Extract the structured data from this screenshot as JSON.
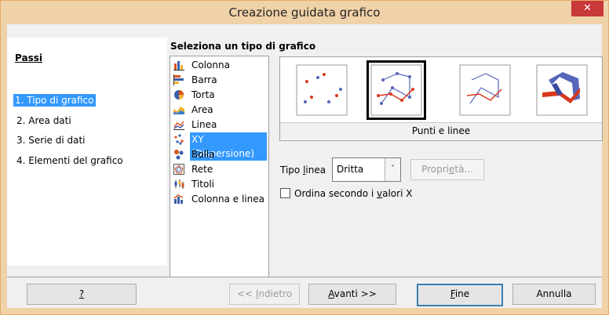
{
  "window": {
    "title": "Creazione guidata grafico",
    "close_glyph": "✕"
  },
  "steps": {
    "heading": "Passi",
    "items": [
      {
        "label": "1. Tipo di grafico",
        "selected": true
      },
      {
        "label": "2. Area dati",
        "selected": false
      },
      {
        "label": "3. Serie di dati",
        "selected": false
      },
      {
        "label": "4. Elementi del grafico",
        "selected": false
      }
    ]
  },
  "chart_type": {
    "heading": "Seleziona un tipo di grafico",
    "types": [
      {
        "label": "Colonna",
        "icon": "column-chart-icon"
      },
      {
        "label": "Barra",
        "icon": "bar-chart-icon"
      },
      {
        "label": "Torta",
        "icon": "pie-chart-icon"
      },
      {
        "label": "Area",
        "icon": "area-chart-icon"
      },
      {
        "label": "Linea",
        "icon": "line-chart-icon"
      },
      {
        "label": "XY (Dispersione)",
        "icon": "xy-scatter-icon",
        "selected": true
      },
      {
        "label": "Bolla",
        "icon": "bubble-chart-icon"
      },
      {
        "label": "Rete",
        "icon": "net-chart-icon"
      },
      {
        "label": "Titoli",
        "icon": "stock-chart-icon"
      },
      {
        "label": "Colonna e linea",
        "icon": "column-line-chart-icon"
      }
    ],
    "variants": [
      {
        "name": "points-only",
        "icon": "points-only-icon"
      },
      {
        "name": "points-and-lines",
        "icon": "points-lines-icon",
        "selected": true
      },
      {
        "name": "lines-only",
        "icon": "lines-only-icon"
      },
      {
        "name": "3d-lines",
        "icon": "3d-lines-icon"
      }
    ],
    "variant_caption": "Punti e linee"
  },
  "options": {
    "line_type_label_pre": "Tipo ",
    "line_type_label_key": "l",
    "line_type_label_post": "inea",
    "line_type_value": "Dritta",
    "properties_pre": "Propri",
    "properties_key": "e",
    "properties_post": "tà...",
    "sort_pre": "Ordina secondo i ",
    "sort_key": "v",
    "sort_post": "alori X",
    "sort_checked": false
  },
  "footer": {
    "help": "?",
    "back_pre": "<< ",
    "back_key": "I",
    "back_post": "ndietro",
    "next_key": "A",
    "next_post": "vanti >>",
    "finish_key": "F",
    "finish_post": "ine",
    "cancel": "Annulla"
  },
  "colors": {
    "selection": "#3399ff",
    "title_bar": "#f0d2a8",
    "close": "#c8393a"
  }
}
